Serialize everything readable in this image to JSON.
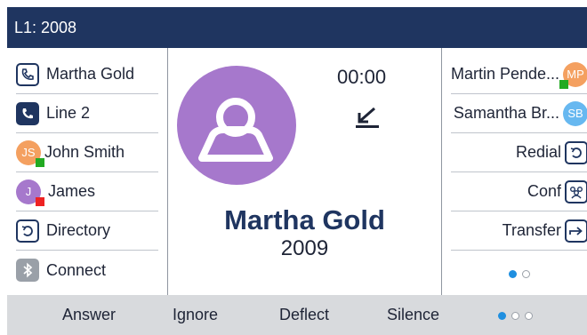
{
  "title": "L1: 2008",
  "left_keys": [
    {
      "label": "Martha Gold",
      "icon": "phone-icon"
    },
    {
      "label": "Line 2",
      "icon": "phone-filled-icon"
    },
    {
      "label": "John Smith",
      "avatar": "JS",
      "avatar_color": "#f4a060",
      "presence_color": "#22aa22"
    },
    {
      "label": "James",
      "avatar": "J",
      "avatar_color": "#a678cc",
      "presence_color": "#ee2222"
    },
    {
      "label": "Directory",
      "icon": "directory-icon"
    },
    {
      "label": "Connect",
      "icon": "bluetooth-icon"
    }
  ],
  "call": {
    "timer": "00:00",
    "status_icon": "incoming-call-arrow-icon",
    "caller_name": "Martha Gold",
    "caller_number": "2009",
    "avatar_color": "#a678cc"
  },
  "right_keys": [
    {
      "label": "Martin Pende...",
      "avatar": "MP",
      "avatar_color": "#f4a060",
      "presence_color": "#22aa22"
    },
    {
      "label": "Samantha Br...",
      "avatar": "SB",
      "avatar_color": "#67b8f0"
    },
    {
      "label": "Redial",
      "icon": "redial-icon"
    },
    {
      "label": "Conf",
      "icon": "conference-icon"
    },
    {
      "label": "Transfer",
      "icon": "transfer-icon"
    }
  ],
  "softkeys": [
    "Answer",
    "Ignore",
    "Deflect",
    "Silence"
  ],
  "colors": {
    "title_bg": "#1f3560",
    "softbar_bg": "#d8dadd",
    "page_dot_active": "#1f8fe0"
  }
}
